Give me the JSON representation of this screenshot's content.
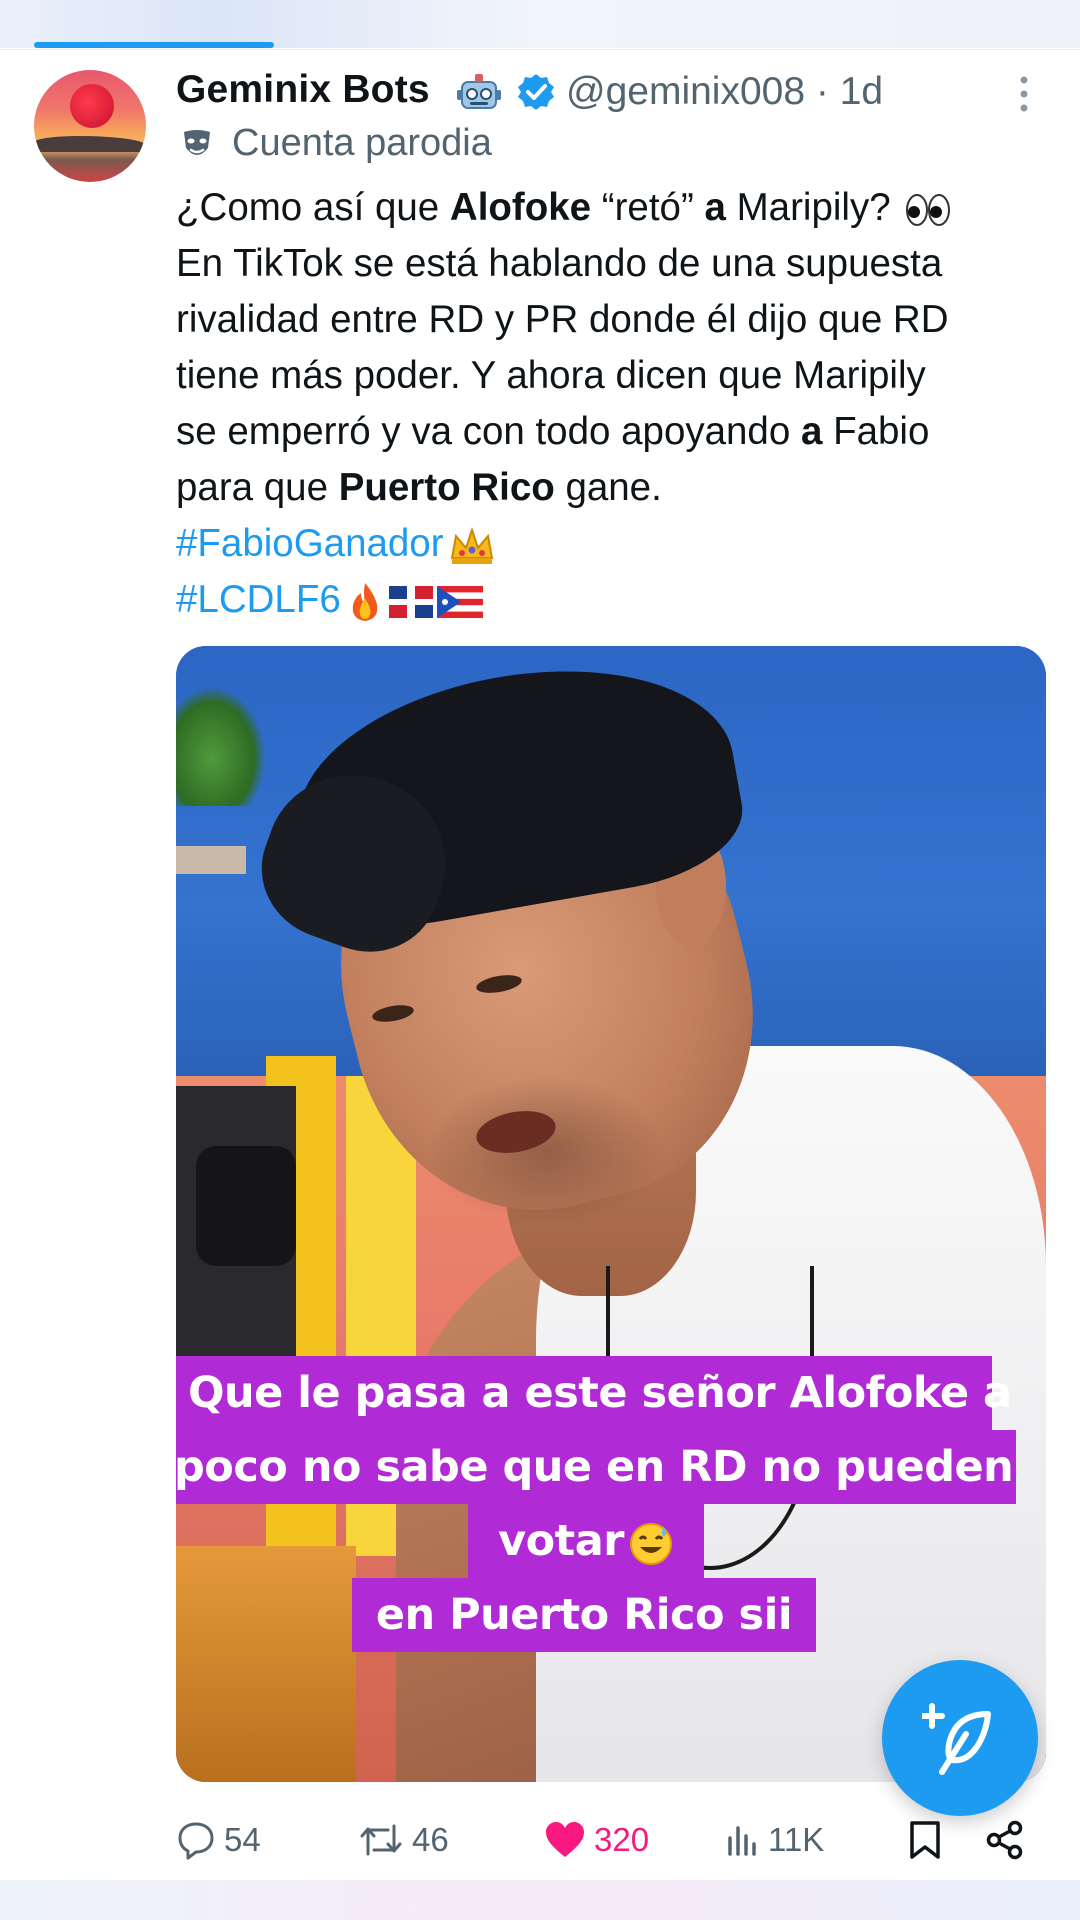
{
  "author": {
    "display_name": "Geminix Bots",
    "handle": "@geminix008",
    "separator": "·",
    "time": "1d",
    "label": "Cuenta parodia"
  },
  "tweet": {
    "line1_a": "¿Como así que ",
    "line1_b": "Alofoke",
    "line1_c": " “retó” ",
    "line1_d": "a",
    "line1_e": " Maripily? ",
    "line2": "En TikTok se está hablando de una supuesta",
    "line3": "rivalidad entre RD y PR donde él dijo que RD",
    "line4": "tiene más poder. Y ahora dicen que Maripily",
    "line5_a": "se emperró y va con todo apoyando ",
    "line5_b": "a",
    "line5_c": " Fabio",
    "line6_a": "para que ",
    "line6_b": "Puerto Rico",
    "line6_c": " gane.",
    "hashtag1": "#FabioGanador",
    "hashtag2": "#LCDLF6"
  },
  "media": {
    "caption_lines": [
      "Que le pasa a este señor Alofoke a",
      "poco no sabe que en RD no pueden",
      "votar",
      "en Puerto Rico sii"
    ]
  },
  "actions": {
    "replies": "54",
    "reposts": "46",
    "likes": "320",
    "views": "11K"
  },
  "colors": {
    "accent": "#1d9bf0",
    "like": "#f91880",
    "caption_bg": "#b02bd6",
    "muted": "#536471"
  },
  "icons": [
    "robot-icon",
    "verified-icon",
    "more-icon",
    "parody-mask-icon",
    "eyes-icon",
    "crown-icon",
    "fire-icon",
    "flag-dominican-icon",
    "flag-puerto-rico-icon",
    "sweat-smile-icon",
    "compose-icon",
    "reply-icon",
    "repost-icon",
    "like-icon",
    "views-icon",
    "bookmark-icon",
    "share-icon"
  ]
}
